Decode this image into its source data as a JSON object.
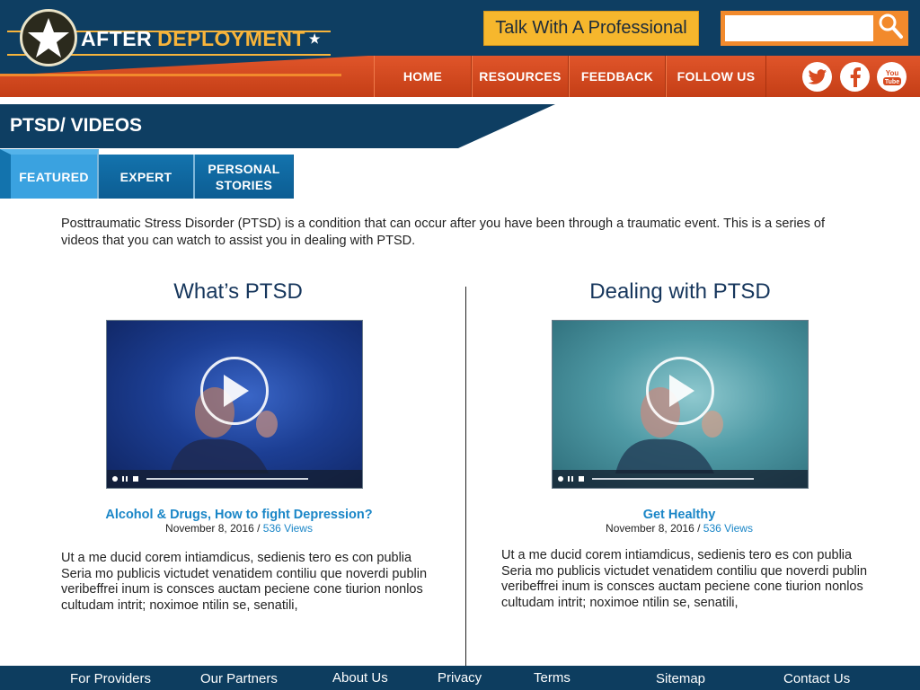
{
  "brand": {
    "name_part1": "AFTER",
    "name_part2": "DEPLOYMENT",
    "star": "★",
    "colors": {
      "navy": "#0e3e62",
      "orange": "#e0552a",
      "gold": "#f7b43b",
      "link_blue": "#1a86c7"
    }
  },
  "header": {
    "talk_button": "Talk With A Professional",
    "search": {
      "placeholder": "",
      "icon": "search-icon"
    },
    "nav": [
      "HOME",
      "RESOURCES",
      "FEEDBACK",
      "FOLLOW US"
    ],
    "social": [
      "twitter-icon",
      "facebook-icon",
      "youtube-icon"
    ]
  },
  "page": {
    "title": "PTSD/ VIDEOS",
    "tabs": [
      {
        "label": "FEATURED",
        "active": true
      },
      {
        "label": "EXPERT",
        "active": false
      },
      {
        "label": "PERSONAL STORIES",
        "active": false
      }
    ],
    "intro": "Posttraumatic Stress Disorder (PTSD) is a condition that can occur after you have been through a traumatic event. This is a series of videos that you can watch to assist you in dealing with PTSD."
  },
  "videos": [
    {
      "section_title": "What’s PTSD",
      "link": "Alcohol & Drugs, How to fight Depression?",
      "date": "November 8,  2016 /",
      "views": "536 Views",
      "description": "Ut a me ducid corem intiamdicus, sedienis tero es con publia Seria mo publicis victudet venatidem contiliu que noverdi publin veribeffrei inum is consces auctam peciene cone tiurion nonlos cultudam intrit; noximoe ntilin se, senatili,"
    },
    {
      "section_title": "Dealing with PTSD",
      "link": "Get Healthy",
      "date": "November 8,  2016 /",
      "views": "536 Views",
      "description": "Ut a me ducid corem intiamdicus, sedienis tero es con publia Seria mo publicis victudet venatidem contiliu que noverdi publin veribeffrei inum is consces auctam peciene cone tiurion nonlos cultudam intrit; noximoe ntilin se, senatili,"
    }
  ],
  "footer": {
    "links": [
      "For Providers",
      "Our Partners",
      "About Us",
      "Privacy",
      "Terms",
      "Sitemap",
      "Contact Us"
    ]
  }
}
